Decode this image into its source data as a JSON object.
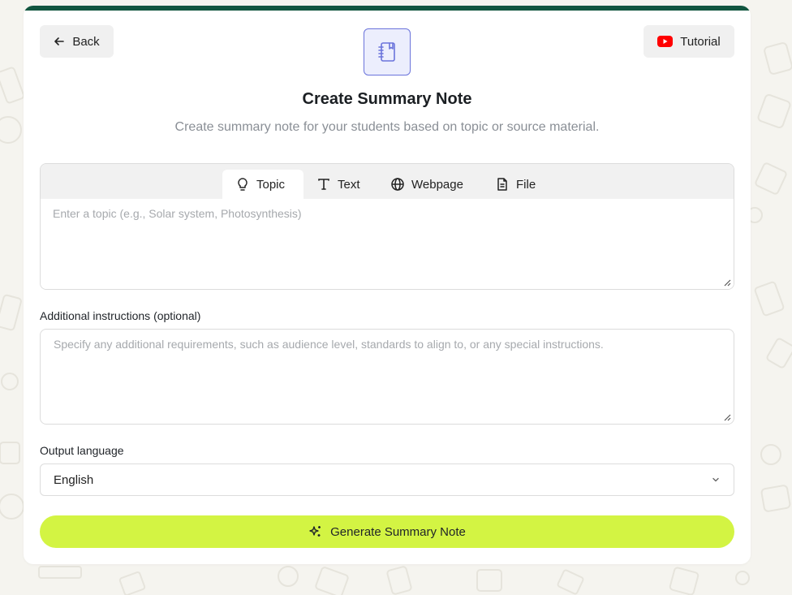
{
  "header": {
    "back_label": "Back",
    "tutorial_label": "Tutorial",
    "title": "Create Summary Note",
    "subtitle": "Create summary note for your students based on topic or source material."
  },
  "source_tabs": [
    {
      "label": "Topic",
      "icon": "lightbulb-icon",
      "active": true
    },
    {
      "label": "Text",
      "icon": "text-icon",
      "active": false
    },
    {
      "label": "Webpage",
      "icon": "globe-icon",
      "active": false
    },
    {
      "label": "File",
      "icon": "file-icon",
      "active": false
    }
  ],
  "topic_input": {
    "value": "",
    "placeholder": "Enter a topic (e.g., Solar system, Photosynthesis)"
  },
  "instructions": {
    "label": "Additional instructions (optional)",
    "value": "",
    "placeholder": "Specify any additional requirements, such as audience level, standards to align to, or any special instructions."
  },
  "language": {
    "label": "Output language",
    "selected": "English"
  },
  "generate_label": "Generate Summary Note",
  "colors": {
    "brand_bar": "#11553f",
    "accent": "#d3f443",
    "hero_icon": "#6b74db",
    "youtube": "#ff0000"
  }
}
